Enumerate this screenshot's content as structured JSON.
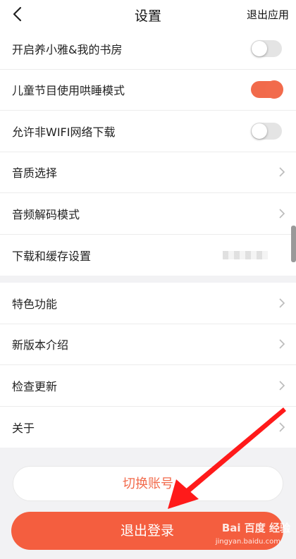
{
  "header": {
    "title": "设置",
    "exit_app": "退出应用"
  },
  "group1": [
    {
      "label": "开启养小雅&我的书房",
      "control": "toggle",
      "on": false
    },
    {
      "label": "儿童节目使用哄睡模式",
      "control": "toggle",
      "on": true
    },
    {
      "label": "允许非WIFI网络下载",
      "control": "toggle",
      "on": false
    },
    {
      "label": "音质选择",
      "control": "chevron"
    },
    {
      "label": "音频解码模式",
      "control": "chevron"
    },
    {
      "label": "下载和缓存设置",
      "control": "blurred-value"
    }
  ],
  "group2": [
    {
      "label": "特色功能"
    },
    {
      "label": "新版本介绍"
    },
    {
      "label": "检查更新"
    },
    {
      "label": "关于"
    }
  ],
  "buttons": {
    "switch_account": "切换账号",
    "logout": "退出登录"
  },
  "watermark": {
    "brand": "Bai 百度 经验",
    "url": "jingyan.baidu.com"
  },
  "colors": {
    "accent": "#f26b4c",
    "logout_bg": "#f45e3f",
    "annotation_arrow": "#ff1a1a"
  }
}
